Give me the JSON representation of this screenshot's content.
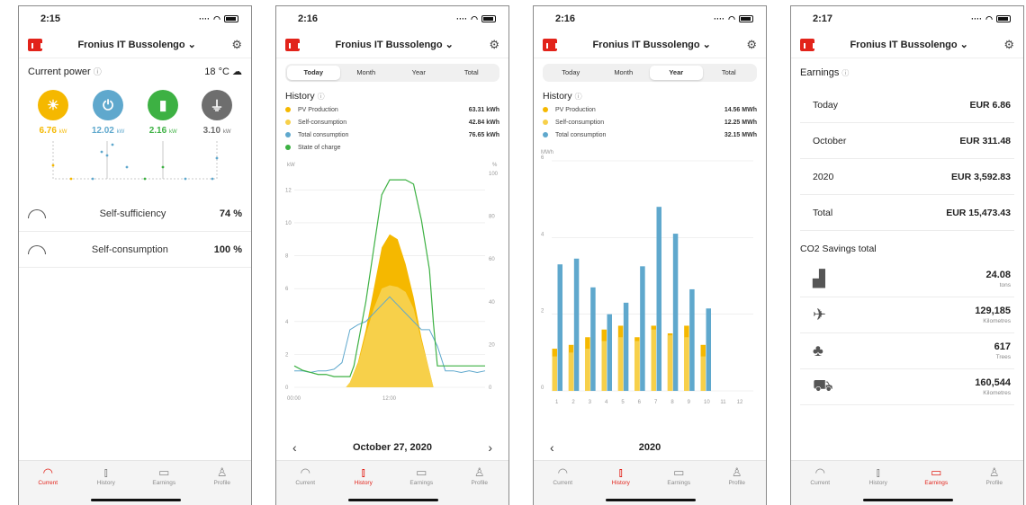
{
  "colors": {
    "accent": "#e2231a",
    "pv": "#f5b800",
    "selfcons": "#f7d04a",
    "consumption": "#5fa8cd",
    "charge": "#3db143",
    "grid": "#6e6e6e"
  },
  "app": {
    "plant_name": "Fronius IT Bussolengo",
    "settings_icon": "gear-icon"
  },
  "tabs": [
    "Current",
    "History",
    "Earnings",
    "Profile"
  ],
  "screens": [
    {
      "time": "2:15",
      "current": {
        "title": "Current power",
        "temperature": "18 °C",
        "flows": [
          {
            "name": "pv",
            "value": "6.76",
            "unit": "kW",
            "icon": "sun-icon"
          },
          {
            "name": "load",
            "value": "12.02",
            "unit": "kW",
            "icon": "plug-icon"
          },
          {
            "name": "battery",
            "value": "2.16",
            "unit": "kW",
            "icon": "battery-car-icon"
          },
          {
            "name": "grid",
            "value": "3.10",
            "unit": "kW",
            "icon": "pylon-icon"
          }
        ],
        "kpis": [
          {
            "label": "Self-sufficiency",
            "value": "74 %"
          },
          {
            "label": "Self-consumption",
            "value": "100 %"
          }
        ]
      }
    },
    {
      "time": "2:16",
      "segment": [
        "Today",
        "Month",
        "Year",
        "Total"
      ],
      "selected": "Today",
      "history_title": "History",
      "legend": [
        {
          "label": "PV Production",
          "value": "63.31 kWh",
          "color": "#f5b800"
        },
        {
          "label": "Self-consumption",
          "value": "42.84 kWh",
          "color": "#f7d04a"
        },
        {
          "label": "Total consumption",
          "value": "76.65 kWh",
          "color": "#5fa8cd"
        },
        {
          "label": "State of charge",
          "value": "",
          "color": "#3db143"
        }
      ],
      "date": "October 27, 2020"
    },
    {
      "time": "2:16",
      "segment": [
        "Today",
        "Month",
        "Year",
        "Total"
      ],
      "selected": "Year",
      "history_title": "History",
      "legend": [
        {
          "label": "PV Production",
          "value": "14.56 MWh",
          "color": "#f5b800"
        },
        {
          "label": "Self-consumption",
          "value": "12.25 MWh",
          "color": "#f7d04a"
        },
        {
          "label": "Total consumption",
          "value": "32.15 MWh",
          "color": "#5fa8cd"
        }
      ],
      "date": "2020"
    },
    {
      "time": "2:17",
      "earnings": {
        "title": "Earnings",
        "rows": [
          {
            "label": "Today",
            "value": "EUR 6.86"
          },
          {
            "label": "October",
            "value": "EUR 311.48"
          },
          {
            "label": "2020",
            "value": "EUR 3,592.83"
          },
          {
            "label": "Total",
            "value": "EUR 15,473.43"
          }
        ],
        "co2_title": "CO2 Savings total",
        "co2": [
          {
            "icon": "factory-icon",
            "value": "24.08",
            "unit": "tons"
          },
          {
            "icon": "airplane-icon",
            "value": "129,185",
            "unit": "Kilometres"
          },
          {
            "icon": "trees-icon",
            "value": "617",
            "unit": "Trees"
          },
          {
            "icon": "car-icon",
            "value": "160,544",
            "unit": "Kilometres"
          }
        ]
      }
    }
  ],
  "chart_data": [
    {
      "type": "area",
      "xlabel": "",
      "x_ticks": [
        "00:00",
        "12:00"
      ],
      "y_left": {
        "label": "kW",
        "ticks": [
          0,
          2,
          4,
          6,
          8,
          10,
          12
        ],
        "range": [
          0,
          13
        ]
      },
      "y_right": {
        "label": "%",
        "ticks": [
          0,
          20,
          40,
          60,
          80,
          100
        ],
        "range": [
          0,
          100
        ]
      },
      "series": [
        {
          "name": "PV Production",
          "x": [
            0,
            6.5,
            7,
            8,
            9,
            10,
            11,
            12,
            13,
            14,
            15,
            16,
            17,
            17.5,
            24
          ],
          "values": [
            0,
            0,
            0.3,
            1.5,
            3.5,
            6.0,
            8.5,
            9.3,
            9.0,
            7.5,
            5.5,
            3.0,
            1.0,
            0,
            0
          ]
        },
        {
          "name": "Self-consumption",
          "x": [
            0,
            6.5,
            7,
            8,
            9,
            10,
            11,
            12,
            13,
            14,
            15,
            16,
            17,
            17.5,
            24
          ],
          "values": [
            0,
            0,
            0.3,
            1.4,
            3.2,
            4.8,
            6.0,
            6.2,
            6.1,
            5.8,
            4.8,
            2.8,
            1.0,
            0,
            0
          ]
        },
        {
          "name": "Total consumption",
          "x": [
            0,
            1,
            2,
            3,
            4,
            5,
            6,
            7,
            8,
            9,
            10,
            11,
            12,
            13,
            14,
            15,
            16,
            17,
            18,
            19,
            20,
            21,
            22,
            23,
            24
          ],
          "values": [
            1.0,
            1.0,
            0.9,
            1.0,
            1.0,
            1.1,
            1.5,
            3.5,
            3.8,
            4.0,
            4.5,
            5.0,
            5.5,
            5.0,
            4.5,
            4.0,
            3.5,
            3.5,
            2.5,
            1.0,
            1.0,
            0.9,
            1.0,
            0.9,
            1.0
          ]
        },
        {
          "name": "State of charge",
          "x": [
            0,
            1,
            2,
            3,
            4,
            5,
            6,
            7,
            7.5,
            8,
            9,
            10,
            11,
            12,
            13,
            14,
            15,
            16,
            17,
            17.5,
            18,
            20,
            22,
            24
          ],
          "values": [
            10,
            8,
            7,
            6,
            6,
            5,
            5,
            5,
            10,
            20,
            40,
            65,
            90,
            97,
            97,
            97,
            95,
            78,
            55,
            30,
            10,
            10,
            10,
            10
          ]
        }
      ]
    },
    {
      "type": "bar",
      "ylabel": "MWh",
      "y_ticks": [
        0,
        2,
        4,
        6
      ],
      "ylim": [
        0,
        6
      ],
      "categories": [
        "1",
        "2",
        "3",
        "4",
        "5",
        "6",
        "7",
        "8",
        "9",
        "10",
        "11",
        "12"
      ],
      "series": [
        {
          "name": "PV Production",
          "values": [
            1.1,
            1.2,
            1.4,
            1.6,
            1.7,
            1.4,
            1.7,
            1.5,
            1.7,
            1.2,
            0,
            0
          ]
        },
        {
          "name": "Self-consumption",
          "values": [
            0.9,
            1.0,
            1.1,
            1.3,
            1.4,
            1.3,
            1.6,
            1.45,
            1.4,
            0.9,
            0,
            0
          ]
        },
        {
          "name": "Total consumption",
          "values": [
            3.3,
            3.45,
            2.7,
            2.0,
            2.3,
            3.25,
            4.8,
            4.1,
            2.65,
            2.15,
            0,
            0
          ]
        }
      ]
    }
  ]
}
